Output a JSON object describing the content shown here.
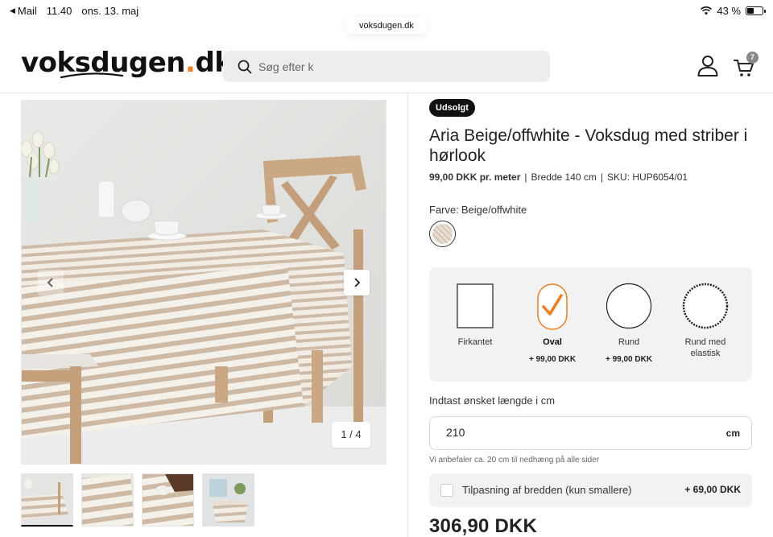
{
  "status_bar": {
    "back_app": "Mail",
    "time": "11.40",
    "date": "ons. 13. maj",
    "battery": "43 %",
    "battery_level": 0.43
  },
  "browser": {
    "url": "voksdugen.dk"
  },
  "header": {
    "logo_main": "voksdugen",
    "logo_dot": ".",
    "logo_tld": "dk",
    "search_placeholder": "Søg efter k",
    "cart_count": "7"
  },
  "gallery": {
    "counter": "1 / 4",
    "thumbnails": 4,
    "active_index": 0
  },
  "product": {
    "badge": "Udsolgt",
    "title": "Aria Beige/offwhite - Voksdug med striber i hørlook",
    "price_per_meter": "99,00 DKK pr. meter",
    "separator": "|",
    "width": "Bredde 140 cm",
    "sku": "SKU: HUP6054/01",
    "colour_label": "Farve:",
    "colour_value": "Beige/offwhite"
  },
  "shapes": [
    {
      "label": "Firkantet",
      "price": "",
      "selected": false
    },
    {
      "label": "Oval",
      "price": "+ 99,00 DKK",
      "selected": true
    },
    {
      "label": "Rund",
      "price": "+ 99,00 DKK",
      "selected": false
    },
    {
      "label": "Rund med elastisk",
      "price": "",
      "selected": false
    }
  ],
  "length": {
    "label": "Indtast ønsket længde i cm",
    "value": "210",
    "unit": "cm",
    "hint": "Vi anbefaler ca. 20 cm til nedhæng på alle sider"
  },
  "fit_option": {
    "label": "Tilpasning af bredden (kun smallere)",
    "price": "+ 69,00 DKK",
    "checked": false
  },
  "total": "306,90 DKK",
  "colors": {
    "accent": "#f07c1a",
    "badge_bg": "#111111",
    "panel_bg": "#f2f2f2"
  }
}
